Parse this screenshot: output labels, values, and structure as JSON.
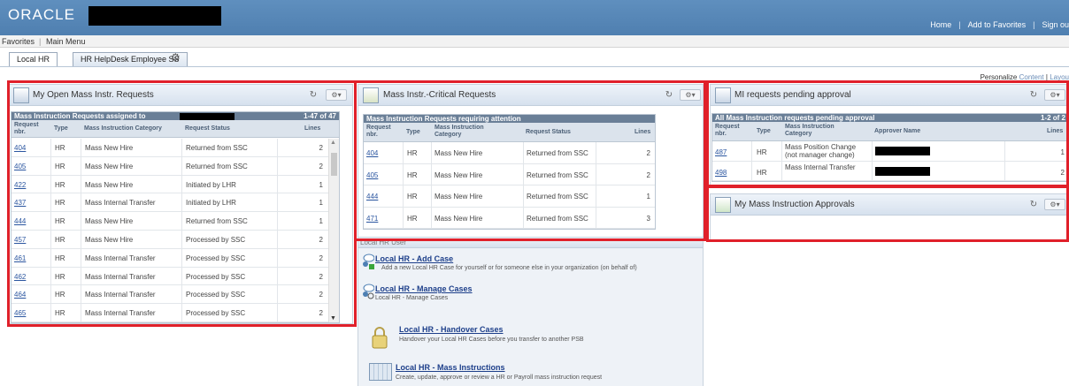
{
  "header": {
    "logo": "ORACLE",
    "links": [
      "Home",
      "Add to Favorites",
      "Sign ou"
    ],
    "separator": "|"
  },
  "menubar": {
    "favorites": "Favorites",
    "sep": "|",
    "main_menu": "Main Menu"
  },
  "tabs": {
    "local_hr": "Local HR",
    "helpdesk": "HR HelpDesk Employee SS",
    "gear_icon": "gear-icon"
  },
  "personalize": {
    "label": "Personalize",
    "content": "Content",
    "sep": "|",
    "layout": "Layou"
  },
  "colors": {
    "header": "#5f8fbe",
    "grid_header": "#6a7f97",
    "highlight": "#e0202a",
    "link": "#2b56a0"
  },
  "pagelet_open": {
    "title": "My Open Mass Instr. Requests",
    "grid_title": "Mass Instruction Requests assigned to",
    "count": "1-47 of 47",
    "cols": [
      "Request nbr.",
      "Type",
      "Mass Instruction Category",
      "Request Status",
      "Lines"
    ],
    "rows": [
      [
        "404",
        "HR",
        "Mass New Hire",
        "Returned from SSC",
        "2"
      ],
      [
        "405",
        "HR",
        "Mass New Hire",
        "Returned from SSC",
        "2"
      ],
      [
        "422",
        "HR",
        "Mass New Hire",
        "Initiated by LHR",
        "1"
      ],
      [
        "437",
        "HR",
        "Mass Internal Transfer",
        "Initiated by LHR",
        "1"
      ],
      [
        "444",
        "HR",
        "Mass New Hire",
        "Returned from SSC",
        "1"
      ],
      [
        "457",
        "HR",
        "Mass New Hire",
        "Processed by SSC",
        "2"
      ],
      [
        "461",
        "HR",
        "Mass Internal Transfer",
        "Processed by SSC",
        "2"
      ],
      [
        "462",
        "HR",
        "Mass Internal Transfer",
        "Processed by SSC",
        "2"
      ],
      [
        "464",
        "HR",
        "Mass Internal Transfer",
        "Processed by SSC",
        "2"
      ],
      [
        "465",
        "HR",
        "Mass Internal Transfer",
        "Processed by SSC",
        "2"
      ]
    ]
  },
  "pagelet_critical": {
    "title": "Mass Instr.-Critical Requests",
    "grid_title": "Mass Instruction Requests requiring attention",
    "cols": [
      "Request nbr.",
      "Type",
      "Mass Instruction Category",
      "Request Status",
      "Lines"
    ],
    "rows": [
      [
        "404",
        "HR",
        "Mass New Hire",
        "Returned from SSC",
        "2"
      ],
      [
        "405",
        "HR",
        "Mass New Hire",
        "Returned from SSC",
        "2"
      ],
      [
        "444",
        "HR",
        "Mass New Hire",
        "Returned from SSC",
        "1"
      ],
      [
        "471",
        "HR",
        "Mass New Hire",
        "Returned from SSC",
        "3"
      ]
    ]
  },
  "pagelet_pending": {
    "title": "MI requests pending approval",
    "grid_title": "All Mass Instruction requests pending approval",
    "count": "1-2 of 2",
    "cols": [
      "Request nbr.",
      "Type",
      "Mass Instruction Category",
      "Approver Name",
      "Lines"
    ],
    "rows": [
      [
        "487",
        "HR",
        "Mass Position Change (not manager change)",
        "",
        "1"
      ],
      [
        "498",
        "HR",
        "Mass Internal Transfer",
        "",
        "2"
      ]
    ]
  },
  "pagelet_approvals": {
    "title": "My Mass Instruction Approvals"
  },
  "pagelet_localhr": {
    "title": "Local HR User",
    "items": [
      {
        "title": "Local HR - Add Case",
        "desc": "Add a new Local HR Case for yourself or for someone else in your organization (on behalf of)"
      },
      {
        "title": "Local HR - Manage Cases",
        "desc": "Local HR - Manage Cases"
      },
      {
        "title": "Local HR - Handover Cases",
        "desc": "Handover your Local HR Cases before you transfer to another PSB"
      },
      {
        "title": "Local HR - Mass Instructions",
        "desc": "Create, update, approve or review a HR or Payroll mass instruction request"
      }
    ]
  },
  "controls": {
    "refresh": "↻",
    "gear": "⚙▾"
  }
}
